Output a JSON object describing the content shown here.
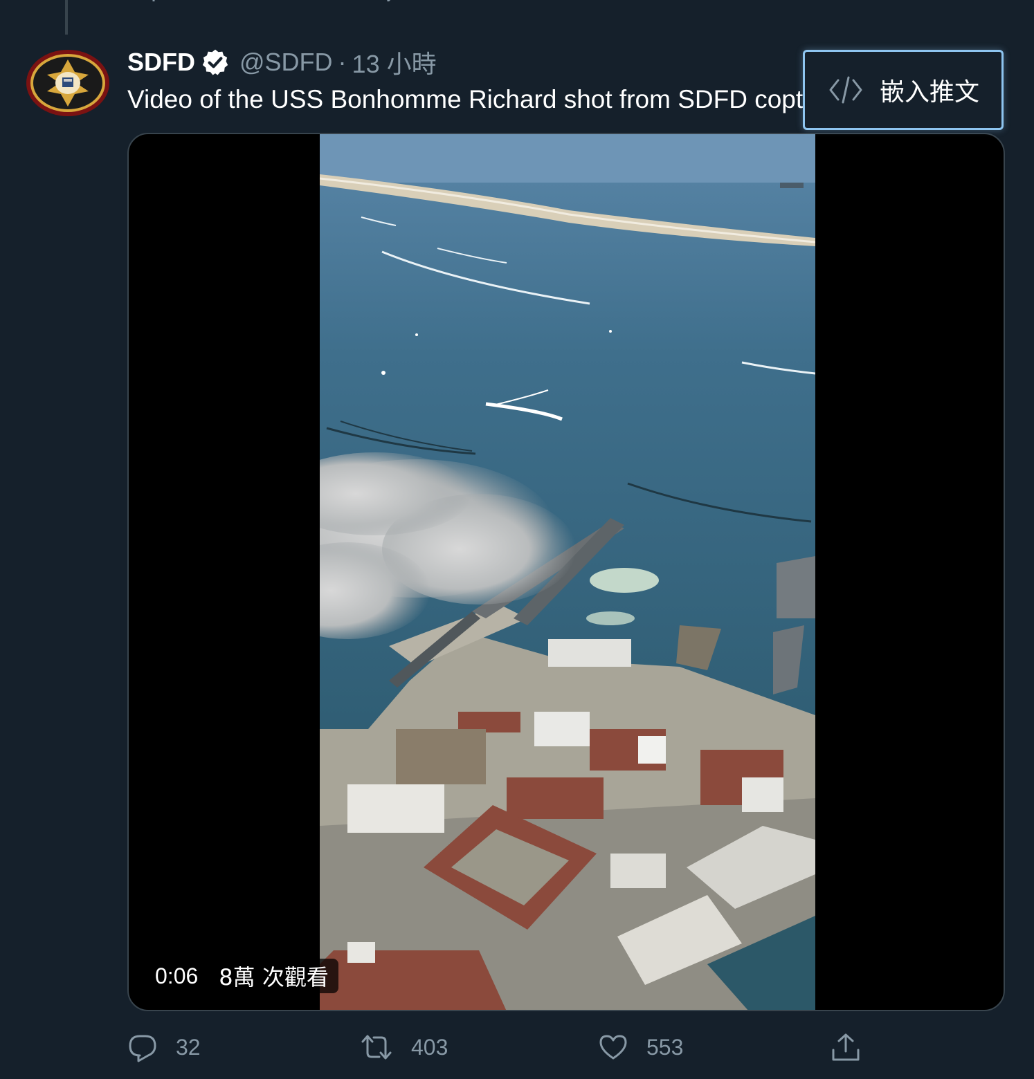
{
  "tweet": {
    "display_name": "SDFD",
    "verified": true,
    "handle": "@SDFD",
    "separator": "·",
    "time": "13 小時",
    "text": "Video of the USS Bonhomme Richard shot from SDFD copter",
    "avatar_icon": "sdfd-fire-rescue-seal-icon",
    "avatar_seal_top_text": "CITY of SAN DIEGO",
    "avatar_seal_bottom_text": "FIRE-RESCUE"
  },
  "embed_menu": {
    "icon": "code-icon",
    "label": "嵌入推文"
  },
  "video": {
    "duration": "0:06",
    "views": "8萬 次觀看"
  },
  "actions": {
    "reply": {
      "icon": "reply-icon",
      "count": "32"
    },
    "retweet": {
      "icon": "retweet-icon",
      "count": "403"
    },
    "like": {
      "icon": "heart-icon",
      "count": "553"
    },
    "share": {
      "icon": "share-icon"
    }
  },
  "colors": {
    "background": "#15202b",
    "secondary_text": "#8899a6",
    "border": "#38444d",
    "focus_ring": "#8ec5f0"
  }
}
